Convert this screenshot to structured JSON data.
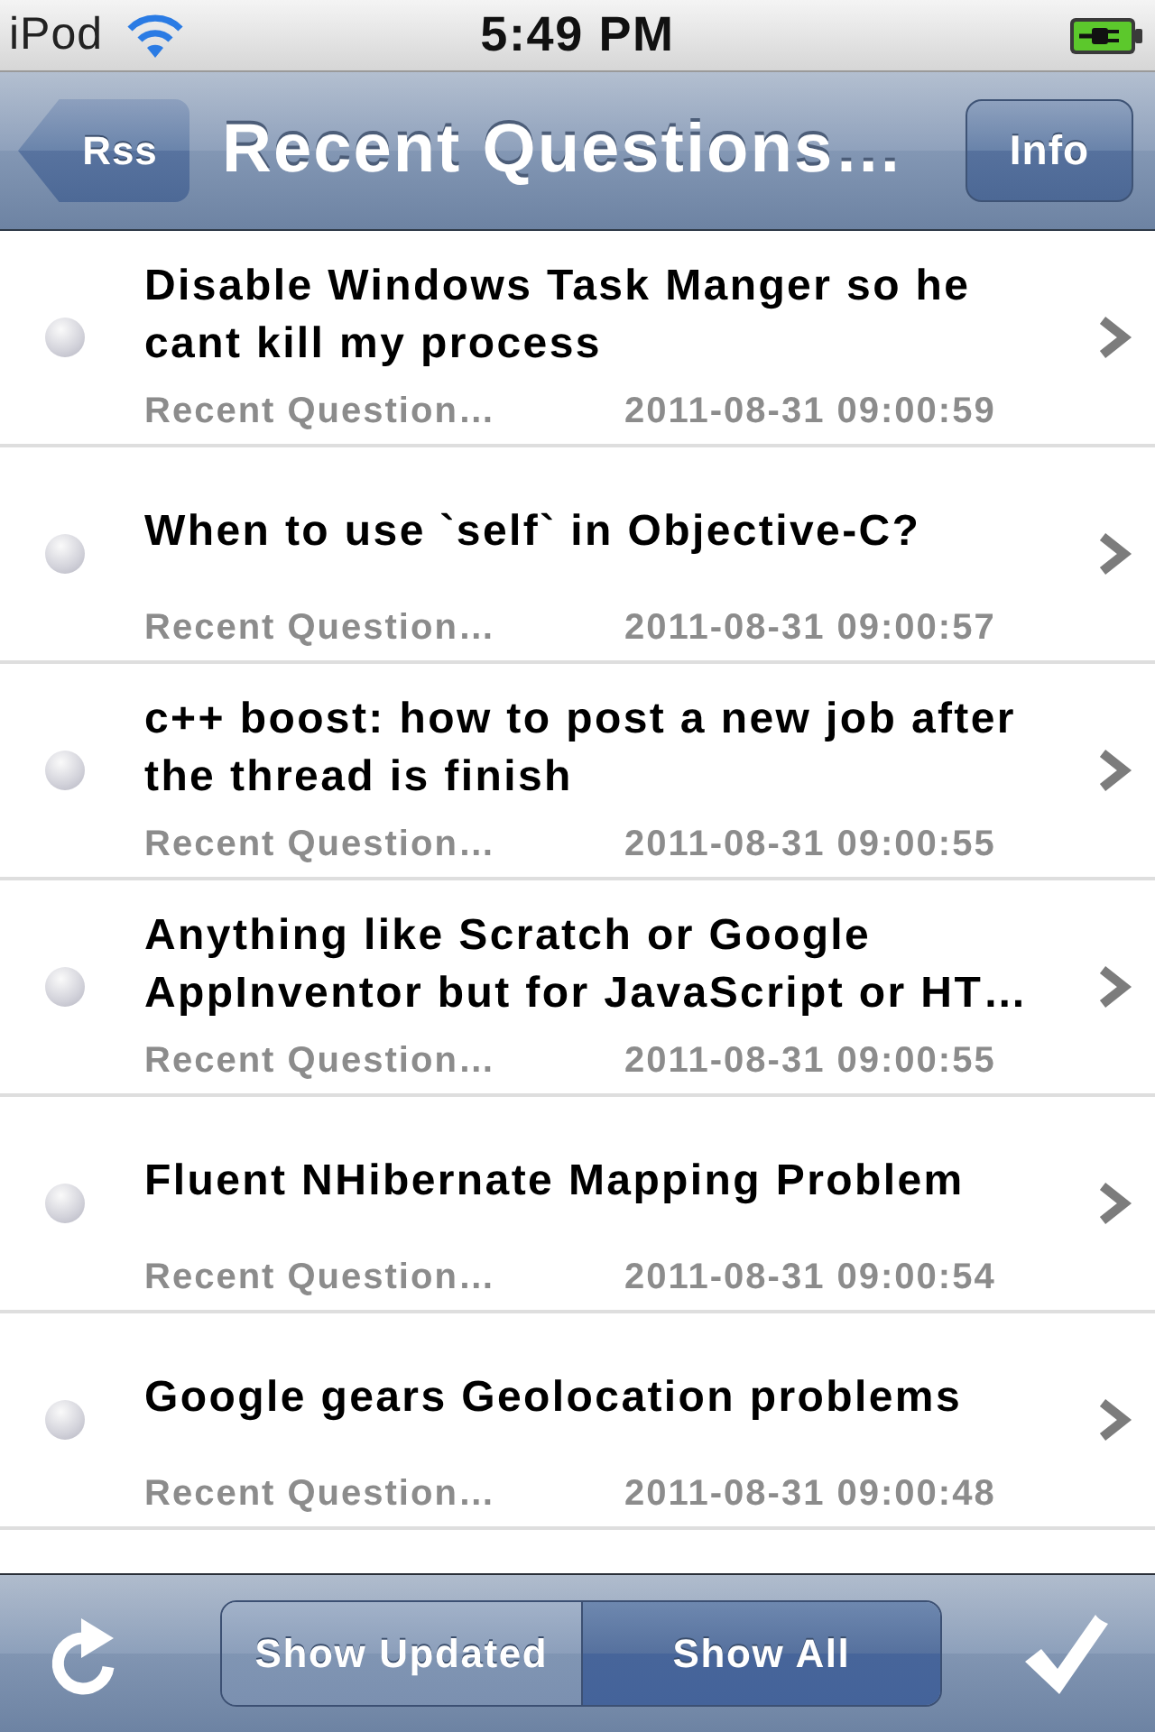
{
  "status_bar": {
    "carrier": "iPod",
    "time": "5:49 PM"
  },
  "nav_bar": {
    "back_button": "Rss",
    "title": "Recent Questions…",
    "right_button": "Info"
  },
  "rows": [
    {
      "title": "Disable Windows Task Manger so he cant kill my process",
      "feed": "Recent Question…",
      "date": "2011-08-31 09:00:59",
      "read": true
    },
    {
      "title": "When to use `self` in Objective-C?",
      "feed": "Recent Question…",
      "date": "2011-08-31 09:00:57",
      "read": true
    },
    {
      "title": "c++ boost: how to post a new job after the thread is finish",
      "feed": "Recent Question…",
      "date": "2011-08-31 09:00:55",
      "read": true
    },
    {
      "title": "Anything like Scratch or Google AppInventor but for JavaScript or HT…",
      "feed": "Recent Question…",
      "date": "2011-08-31 09:00:55",
      "read": true
    },
    {
      "title": "Fluent NHibernate Mapping Problem",
      "feed": "Recent Question…",
      "date": "2011-08-31 09:00:54",
      "read": true
    },
    {
      "title": "Google gears Geolocation problems",
      "feed": "Recent Question…",
      "date": "2011-08-31 09:00:48",
      "read": true
    }
  ],
  "toolbar": {
    "segments": [
      {
        "label": "Show Updated",
        "selected": false
      },
      {
        "label": "Show All",
        "selected": true
      }
    ]
  }
}
